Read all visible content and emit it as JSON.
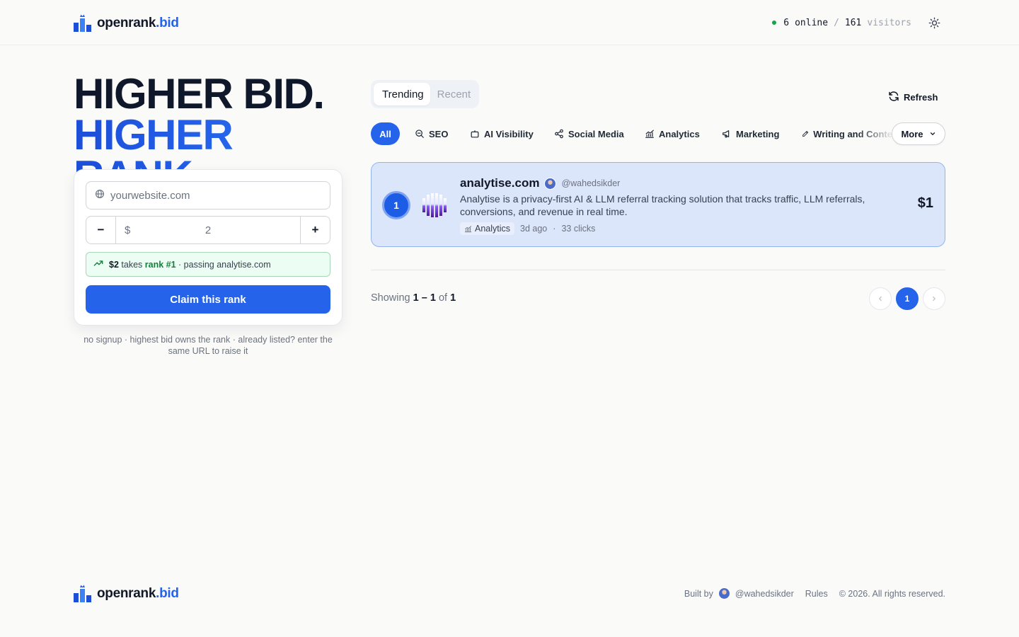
{
  "brand": {
    "name": "openrank",
    "tld": ".bid"
  },
  "header": {
    "online_count": "6",
    "online_label": "online",
    "separator": "/",
    "visitor_count": "161",
    "visitor_label": "visitors",
    "theme_icon": "sun-icon"
  },
  "hero": {
    "line1": "HIGHER BID.",
    "line2": "HIGHER RANK."
  },
  "bid_form": {
    "url_placeholder": "yourwebsite.com",
    "url_icon": "globe-icon",
    "decrement_label": "−",
    "increment_label": "+",
    "currency_symbol": "$",
    "amount": "2",
    "hint_amount": "$2",
    "hint_takes": "takes",
    "hint_rank": "rank #1",
    "hint_passing": "· passing analytise.com",
    "claim_label": "Claim this rank",
    "footnote": "no signup · highest bid owns the rank · already listed? enter the same URL to raise it"
  },
  "feed": {
    "tabs": [
      {
        "label": "Trending",
        "active": true
      },
      {
        "label": "Recent",
        "active": false
      }
    ],
    "refresh_label": "Refresh",
    "categories": [
      {
        "label": "All",
        "icon": "",
        "active": true
      },
      {
        "label": "SEO",
        "icon": "search-icon"
      },
      {
        "label": "AI Visibility",
        "icon": "bot-icon"
      },
      {
        "label": "Social Media",
        "icon": "share-icon"
      },
      {
        "label": "Analytics",
        "icon": "chart-line-icon"
      },
      {
        "label": "Marketing",
        "icon": "megaphone-icon"
      },
      {
        "label": "Writing and Conte",
        "icon": "pencil-icon"
      }
    ],
    "more_label": "More",
    "listings": [
      {
        "rank": "1",
        "domain": "analytise.com",
        "handle": "@wahedsikder",
        "description": "Analytise is a privacy-first AI & LLM referral tracking solution that tracks traffic, LLM referrals, conversions, and revenue in real time.",
        "category": "Analytics",
        "age": "3d ago",
        "dot": "·",
        "clicks": "33 clicks",
        "price": "$1"
      }
    ],
    "showing_prefix": "Showing",
    "showing_range": "1 – 1",
    "showing_of": "of",
    "showing_total": "1",
    "current_page": "1"
  },
  "footer": {
    "built_by": "Built by",
    "author": "@wahedsikder",
    "rules": "Rules",
    "copyright": "© 2026. All rights reserved."
  },
  "colors": {
    "accent": "#2563eb",
    "listing_bg": "#dbe6fb",
    "success": "#15803d",
    "online": "#16a34a"
  }
}
